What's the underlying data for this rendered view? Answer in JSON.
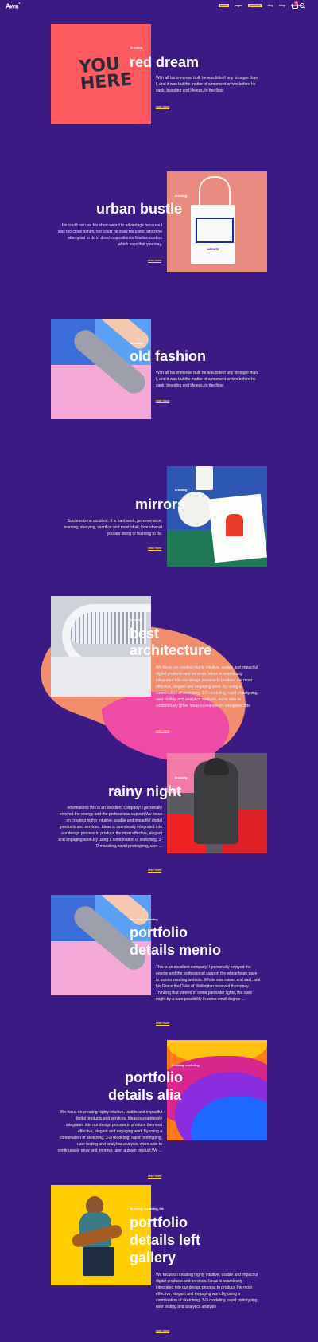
{
  "header": {
    "logo": "Awa",
    "logo_mark": "°",
    "nav": [
      "home",
      "pages",
      "portfolio",
      "blog",
      "shop",
      "elements"
    ],
    "active_nav": "portfolio",
    "cart_count": "0"
  },
  "portfolio": [
    {
      "category": "branding",
      "title": "red dream",
      "description": "With all his immense bulk he was little if any stronger than I, and it was but the matter of a moment or two before he sank, bleeding and lifeless, to the floor.",
      "more": "read more",
      "thumb_text": "YOU HERE"
    },
    {
      "category": "branding",
      "title": "urban bustle",
      "description": "He could not use his short-sword to advantage because I was too close to him, nor could he draw his pistol, which he attempted to do in direct opposition to Martian custom which says that you may.",
      "more": "read more",
      "thumb_text": "AIRDATE"
    },
    {
      "category": "branding",
      "title": "old fashion",
      "description": "With all his immense bulk he was little if any stronger than I, and it was but the matter of a moment or two before he sank, bleeding and lifeless, to the floor.",
      "more": "read more"
    },
    {
      "category": "branding",
      "title": "mirrors",
      "description": "Success is no accident. It is hard work, perseverance, learning, studying, sacrifice and most of all, love of what you are doing or learning to do.",
      "more": "read more"
    },
    {
      "category": "branding",
      "title_lines": [
        "best",
        "architecture"
      ],
      "description": "We focus on creating highly intuitive, usable and impactful digital products and services. Ideas is seamlessly integrated into our design process to produce the most effective, elegant and engaging work. By using a combination of sketching, 3-D modeling, rapid prototyping, user testing and analytics analysis, we're able to continuously grow. Ideas is seamlessly integrated into",
      "more": "read more"
    },
    {
      "category": "branding",
      "title": "rainy night",
      "description": "informations this is an excellent company! I personally enjoyed the energy and the professional support We focus on creating highly intuitive, usable and impactful digital products and services. Ideas is seamlessly integrated into our design process to produce the most effective, elegant and engaging work.By using a combination of sketching, 3-D modeling, rapid prototyping, user ...",
      "more": "read more"
    },
    {
      "category": "branding, marketing",
      "title_lines": [
        "portfolio",
        "details menio"
      ],
      "description": "This is an excellent company! I personally enjoyed the energy and the professional support the whole team gave to us into creating website. Whole was raised and said, and his Grace the Duke of Wellington received themoney. Thinking that viewed in some particular lights, the case might by a bare possibility in some small degree ...",
      "more": "read more"
    },
    {
      "category": "branding, marketing",
      "title_lines": [
        "portfolio",
        "details alia"
      ],
      "description": "We focus on creating highly intuitive, usable and impactful digital products and services. Ideas is seamlessly integrated into our design process to produce the most effective, elegant and engaging work.By using a combination of sketching, 3-D modeling, rapid prototyping, user testing and analytics analysis, we're able to continuously grow and improve upon a given product.We ...",
      "more": "read more"
    },
    {
      "category": "branding, marketing, life",
      "title_lines": [
        "portfolio",
        "details left",
        "gallery"
      ],
      "description": "We focus on creating highly intuitive, usable and impactful digital products and services. Ideas is seamlessly integrated into our design process to produce the most effective, elegant and engaging work.By using a combination of sketching, 3-D modeling, rapid prototyping, user testing and analytics analysis",
      "more": "read more"
    }
  ],
  "colors": {
    "background": "#3c1a84",
    "accent": "#ffd24a",
    "badge": "#ff3f80"
  }
}
